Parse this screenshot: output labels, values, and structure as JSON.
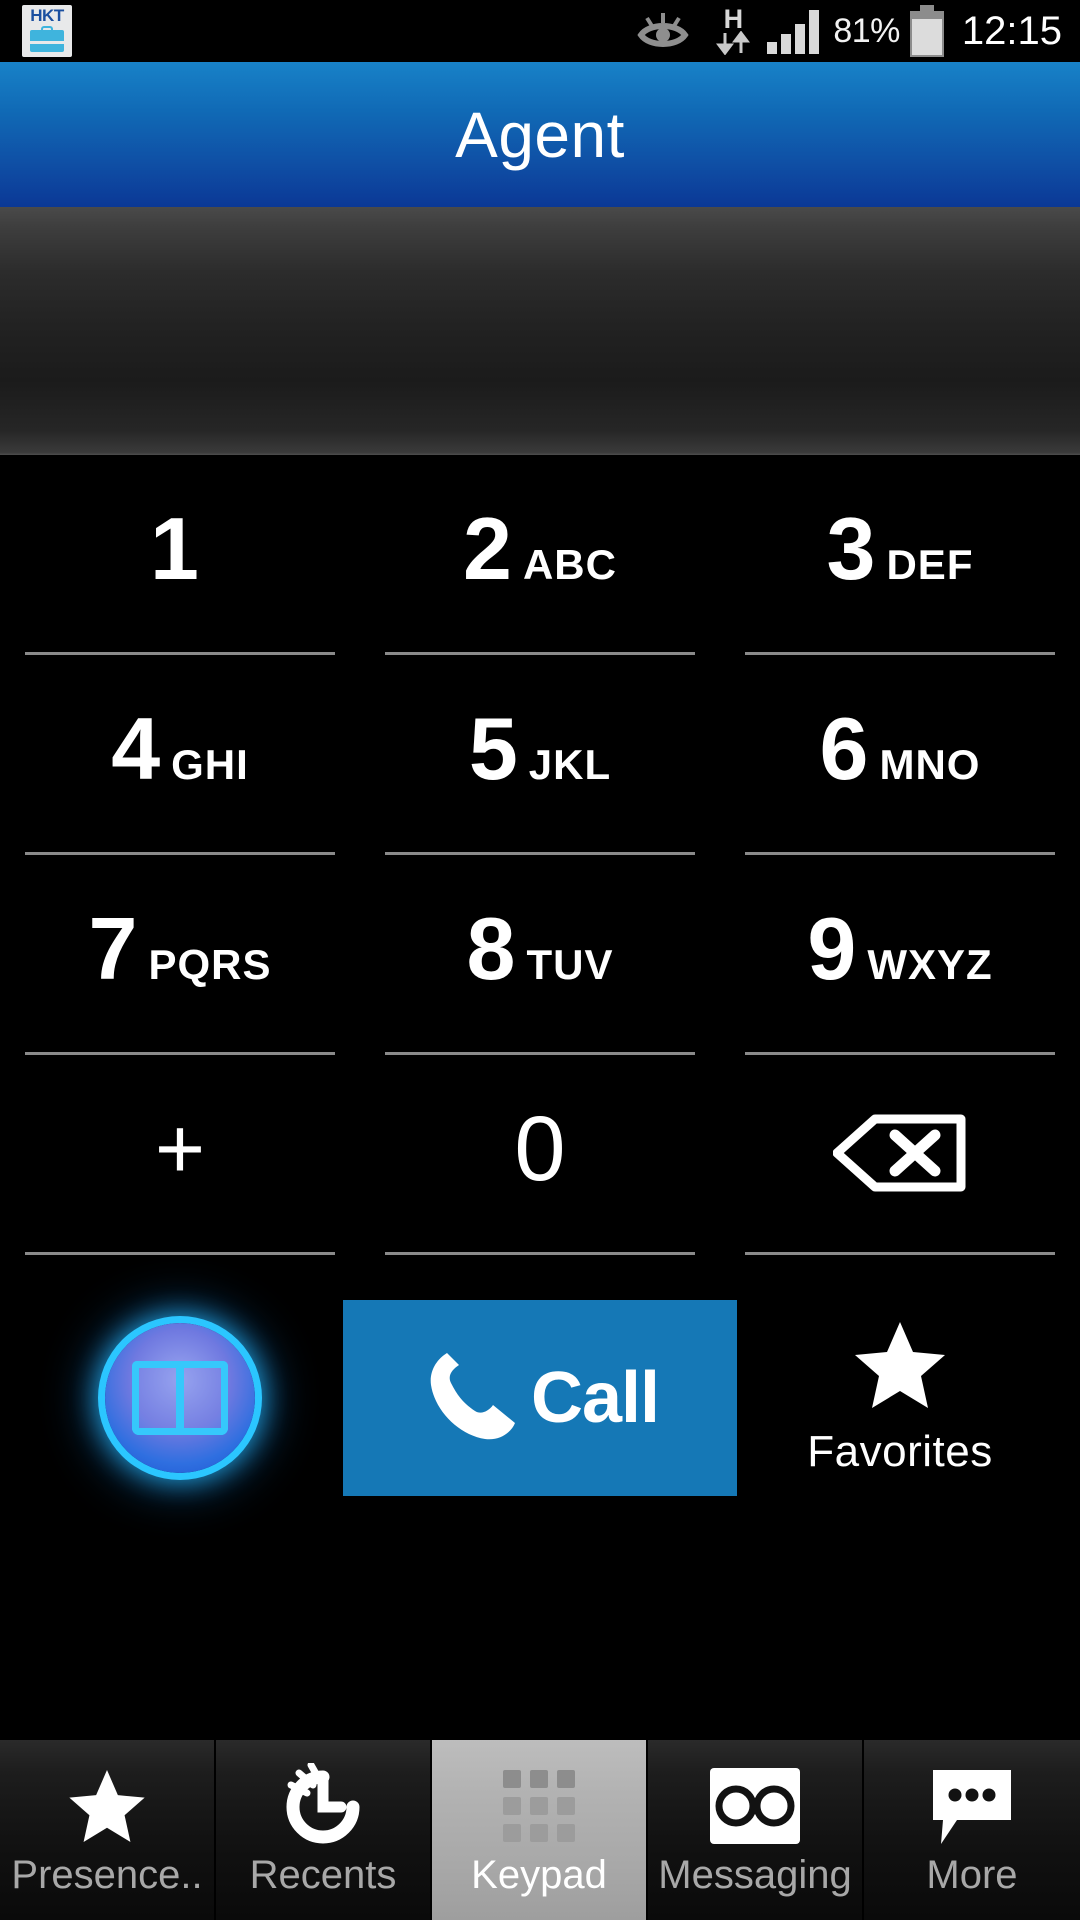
{
  "status_bar": {
    "carrier_badge_text": "HKT",
    "carrier_badge_icon": "briefcase-icon",
    "smart_stay_icon": "eye-icon",
    "network_type": "H",
    "data_arrows_icon": "data-transfer-arrows-icon",
    "signal_icon": "signal-bars-icon",
    "battery_percent": "81%",
    "battery_icon": "battery-icon",
    "clock": "12:15"
  },
  "title_bar": {
    "title": "Agent"
  },
  "number_display": {
    "value": "",
    "placeholder": ""
  },
  "keypad": {
    "rows": [
      [
        {
          "digit": "1",
          "letters": ""
        },
        {
          "digit": "2",
          "letters": "ABC"
        },
        {
          "digit": "3",
          "letters": "DEF"
        }
      ],
      [
        {
          "digit": "4",
          "letters": "GHI"
        },
        {
          "digit": "5",
          "letters": "JKL"
        },
        {
          "digit": "6",
          "letters": "MNO"
        }
      ],
      [
        {
          "digit": "7",
          "letters": "PQRS"
        },
        {
          "digit": "8",
          "letters": "TUV"
        },
        {
          "digit": "9",
          "letters": "WXYZ"
        }
      ]
    ],
    "bottom_row": {
      "plus": "+",
      "zero": "0",
      "backspace_icon": "backspace-icon"
    }
  },
  "actions": {
    "contacts_icon": "address-book-icon",
    "call_label": "Call",
    "call_icon": "phone-handset-icon",
    "call_button_color": "#1578b6",
    "favorites_icon": "star-icon",
    "favorites_label": "Favorites"
  },
  "tab_bar": {
    "tabs": [
      {
        "label": "Presence..",
        "icon": "star-icon",
        "selected": false
      },
      {
        "label": "Recents",
        "icon": "recent-call-icon",
        "selected": false
      },
      {
        "label": "Keypad",
        "icon": "keypad-grid-icon",
        "selected": true
      },
      {
        "label": "Messaging",
        "icon": "voicemail-icon",
        "selected": false
      },
      {
        "label": "More",
        "icon": "speech-bubble-icon",
        "selected": false
      }
    ]
  }
}
